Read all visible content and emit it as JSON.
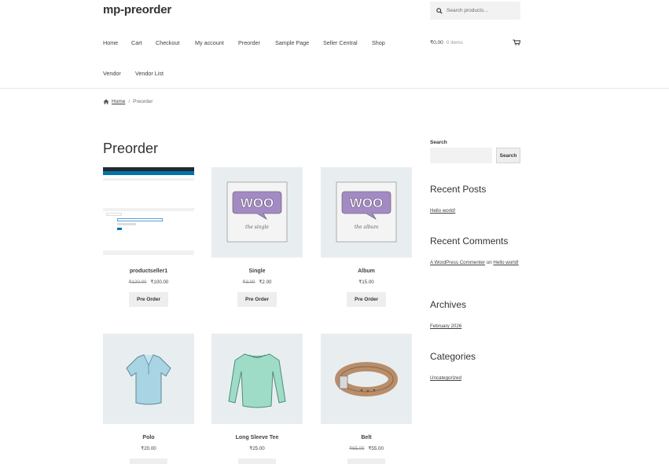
{
  "site": {
    "title": "mp-preorder"
  },
  "search": {
    "placeholder": "Search products…"
  },
  "nav": {
    "items": [
      "Home",
      "Cart",
      "Checkout",
      "My account",
      "Preorder",
      "Sample Page",
      "Seller Central",
      "Shop",
      "Vendor",
      "Vendor List"
    ]
  },
  "cart": {
    "amount": "₹0.00",
    "count": "0 items"
  },
  "breadcrumb": {
    "home": "Home",
    "separator": "/",
    "current": "Preorder"
  },
  "page": {
    "title": "Preorder"
  },
  "products": [
    {
      "name": "productseller1",
      "regular_price": "₹120.00",
      "price": "₹100.00",
      "button": "Pre Order",
      "image": "screenshot-thumbnail"
    },
    {
      "name": "Single",
      "regular_price": "₹3.00",
      "price": "₹2.00",
      "button": "Pre Order",
      "image": "woo-single"
    },
    {
      "name": "Album",
      "regular_price": "",
      "price": "₹15.00",
      "button": "Pre Order",
      "image": "woo-album"
    },
    {
      "name": "Polo",
      "regular_price": "",
      "price": "₹20.00",
      "button": "",
      "image": "polo-shirt"
    },
    {
      "name": "Long Sleeve Tee",
      "regular_price": "",
      "price": "₹25.00",
      "button": "",
      "image": "long-sleeve-tee"
    },
    {
      "name": "Belt",
      "regular_price": "₹65.00",
      "price": "₹55.00",
      "button": "",
      "image": "belt"
    }
  ],
  "sidebar": {
    "search_label": "Search",
    "search_button": "Search",
    "recent_posts_title": "Recent Posts",
    "recent_posts": [
      "Hello world!"
    ],
    "recent_comments_title": "Recent Comments",
    "recent_comment": {
      "author": "A WordPress Commenter",
      "on": "on",
      "post": "Hello world!"
    },
    "archives_title": "Archives",
    "archives": [
      "February 2026"
    ],
    "categories_title": "Categories",
    "categories": [
      "Uncategorized"
    ]
  },
  "woo_labels": {
    "woo": "WOO",
    "single_caption": "the single",
    "album_caption": "the album"
  },
  "colors": {
    "woo_purple": "#a48ac4",
    "tile_bg": "#e8eef0",
    "button_bg": "#eeeeee"
  },
  "icons": [
    "search-icon",
    "cart-icon",
    "home-icon"
  ]
}
